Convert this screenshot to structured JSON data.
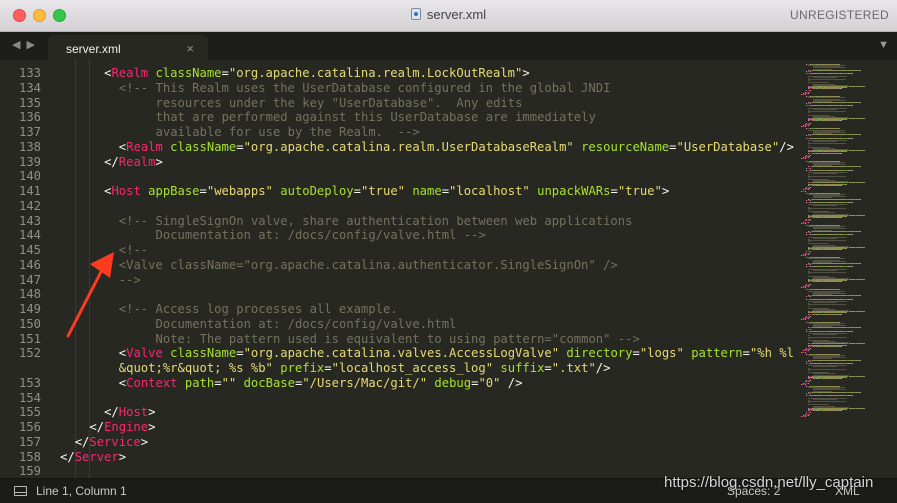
{
  "window": {
    "title": "server.xml",
    "license_text": "UNREGISTERED"
  },
  "tabs": [
    {
      "label": "server.xml",
      "close": "×",
      "active": true
    }
  ],
  "nav": {
    "back": "◀",
    "forward": "▶",
    "tab_menu": "▼"
  },
  "colors": {
    "background": "#272822",
    "tag": "#f92672",
    "attribute": "#a6e22e",
    "string": "#e6db74",
    "comment": "#75715e",
    "text": "#f8f8f2",
    "line_number": "#8f908a"
  },
  "code_lines": [
    {
      "number": "133",
      "indent": 6,
      "tokens": [
        [
          "punct",
          "<"
        ],
        [
          "tag",
          "Realm"
        ],
        [
          "text",
          " "
        ],
        [
          "attr",
          "className"
        ],
        [
          "punct",
          "="
        ],
        [
          "str",
          "\"org.apache.catalina.realm.LockOutRealm\""
        ],
        [
          "punct",
          ">"
        ]
      ]
    },
    {
      "number": "134",
      "indent": 8,
      "tokens": [
        [
          "comment",
          "<!-- This Realm uses the UserDatabase configured in the global JNDI"
        ]
      ]
    },
    {
      "number": "135",
      "indent": 13,
      "tokens": [
        [
          "comment",
          "resources under the key \"UserDatabase\".  Any edits"
        ]
      ]
    },
    {
      "number": "136",
      "indent": 13,
      "tokens": [
        [
          "comment",
          "that are performed against this UserDatabase are immediately"
        ]
      ]
    },
    {
      "number": "137",
      "indent": 13,
      "tokens": [
        [
          "comment",
          "available for use by the Realm.  -->"
        ]
      ]
    },
    {
      "number": "138",
      "indent": 8,
      "tokens": [
        [
          "punct",
          "<"
        ],
        [
          "tag",
          "Realm"
        ],
        [
          "text",
          " "
        ],
        [
          "attr",
          "className"
        ],
        [
          "punct",
          "="
        ],
        [
          "str",
          "\"org.apache.catalina.realm.UserDatabaseRealm\""
        ],
        [
          "text",
          " "
        ],
        [
          "attr",
          "resourceName"
        ],
        [
          "punct",
          "="
        ],
        [
          "str",
          "\"UserDatabase\""
        ],
        [
          "punct",
          "/>"
        ]
      ]
    },
    {
      "number": "139",
      "indent": 6,
      "tokens": [
        [
          "punct",
          "</"
        ],
        [
          "tag",
          "Realm"
        ],
        [
          "punct",
          ">"
        ]
      ]
    },
    {
      "number": "140",
      "indent": 0,
      "tokens": []
    },
    {
      "number": "141",
      "indent": 6,
      "tokens": [
        [
          "punct",
          "<"
        ],
        [
          "tag",
          "Host"
        ],
        [
          "text",
          " "
        ],
        [
          "attr",
          "appBase"
        ],
        [
          "punct",
          "="
        ],
        [
          "str",
          "\"webapps\""
        ],
        [
          "text",
          " "
        ],
        [
          "attr",
          "autoDeploy"
        ],
        [
          "punct",
          "="
        ],
        [
          "str",
          "\"true\""
        ],
        [
          "text",
          " "
        ],
        [
          "attr",
          "name"
        ],
        [
          "punct",
          "="
        ],
        [
          "str",
          "\"localhost\""
        ],
        [
          "text",
          " "
        ],
        [
          "attr",
          "unpackWARs"
        ],
        [
          "punct",
          "="
        ],
        [
          "str",
          "\"true\""
        ],
        [
          "punct",
          ">"
        ]
      ]
    },
    {
      "number": "142",
      "indent": 0,
      "tokens": []
    },
    {
      "number": "143",
      "indent": 8,
      "tokens": [
        [
          "comment",
          "<!-- SingleSignOn valve, share authentication between web applications"
        ]
      ]
    },
    {
      "number": "144",
      "indent": 13,
      "tokens": [
        [
          "comment",
          "Documentation at: /docs/config/valve.html -->"
        ]
      ]
    },
    {
      "number": "145",
      "indent": 8,
      "tokens": [
        [
          "comment",
          "<!--"
        ]
      ]
    },
    {
      "number": "146",
      "indent": 8,
      "tokens": [
        [
          "comment",
          "<Valve className=\"org.apache.catalina.authenticator.SingleSignOn\" />"
        ]
      ]
    },
    {
      "number": "147",
      "indent": 8,
      "tokens": [
        [
          "comment",
          "-->"
        ]
      ]
    },
    {
      "number": "148",
      "indent": 0,
      "tokens": []
    },
    {
      "number": "149",
      "indent": 8,
      "tokens": [
        [
          "comment",
          "<!-- Access log processes all example."
        ]
      ]
    },
    {
      "number": "150",
      "indent": 13,
      "tokens": [
        [
          "comment",
          "Documentation at: /docs/config/valve.html"
        ]
      ]
    },
    {
      "number": "151",
      "indent": 13,
      "tokens": [
        [
          "comment",
          "Note: The pattern used is equivalent to using pattern=\"common\" -->"
        ]
      ]
    },
    {
      "number": "152",
      "indent": 8,
      "tokens": [
        [
          "punct",
          "<"
        ],
        [
          "tag",
          "Valve"
        ],
        [
          "text",
          " "
        ],
        [
          "attr",
          "className"
        ],
        [
          "punct",
          "="
        ],
        [
          "str",
          "\"org.apache.catalina.valves.AccessLogValve\""
        ],
        [
          "text",
          " "
        ],
        [
          "attr",
          "directory"
        ],
        [
          "punct",
          "="
        ],
        [
          "str",
          "\"logs\""
        ],
        [
          "text",
          " "
        ],
        [
          "attr",
          "pattern"
        ],
        [
          "punct",
          "="
        ],
        [
          "str",
          "\"%h %l %u %t"
        ]
      ]
    },
    {
      "number": "",
      "indent": 8,
      "tokens": [
        [
          "str",
          "&quot;%r&quot; %s %b\""
        ],
        [
          "text",
          " "
        ],
        [
          "attr",
          "prefix"
        ],
        [
          "punct",
          "="
        ],
        [
          "str",
          "\"localhost_access_log\""
        ],
        [
          "text",
          " "
        ],
        [
          "attr",
          "suffix"
        ],
        [
          "punct",
          "="
        ],
        [
          "str",
          "\".txt\""
        ],
        [
          "punct",
          "/>"
        ]
      ]
    },
    {
      "number": "153",
      "indent": 8,
      "tokens": [
        [
          "punct",
          "<"
        ],
        [
          "tag",
          "Context"
        ],
        [
          "text",
          " "
        ],
        [
          "attr",
          "path"
        ],
        [
          "punct",
          "="
        ],
        [
          "str",
          "\"\""
        ],
        [
          "text",
          " "
        ],
        [
          "attr",
          "docBase"
        ],
        [
          "punct",
          "="
        ],
        [
          "str",
          "\"/Users/Mac/git/\""
        ],
        [
          "text",
          " "
        ],
        [
          "attr",
          "debug"
        ],
        [
          "punct",
          "="
        ],
        [
          "str",
          "\"0\""
        ],
        [
          "text",
          " "
        ],
        [
          "punct",
          "/>"
        ]
      ]
    },
    {
      "number": "154",
      "indent": 0,
      "tokens": []
    },
    {
      "number": "155",
      "indent": 6,
      "tokens": [
        [
          "punct",
          "</"
        ],
        [
          "tag",
          "Host"
        ],
        [
          "punct",
          ">"
        ]
      ]
    },
    {
      "number": "156",
      "indent": 4,
      "tokens": [
        [
          "punct",
          "</"
        ],
        [
          "tag",
          "Engine"
        ],
        [
          "punct",
          ">"
        ]
      ]
    },
    {
      "number": "157",
      "indent": 2,
      "tokens": [
        [
          "punct",
          "</"
        ],
        [
          "tag",
          "Service"
        ],
        [
          "punct",
          ">"
        ]
      ]
    },
    {
      "number": "158",
      "indent": 0,
      "tokens": [
        [
          "punct",
          "</"
        ],
        [
          "tag",
          "Server"
        ],
        [
          "punct",
          ">"
        ]
      ]
    },
    {
      "number": "159",
      "indent": 0,
      "tokens": []
    }
  ],
  "statusbar": {
    "cursor": "Line 1, Column 1",
    "spaces": "Spaces: 2",
    "syntax": "XML"
  },
  "watermark": "https://blog.csdn.net/lly_captain"
}
